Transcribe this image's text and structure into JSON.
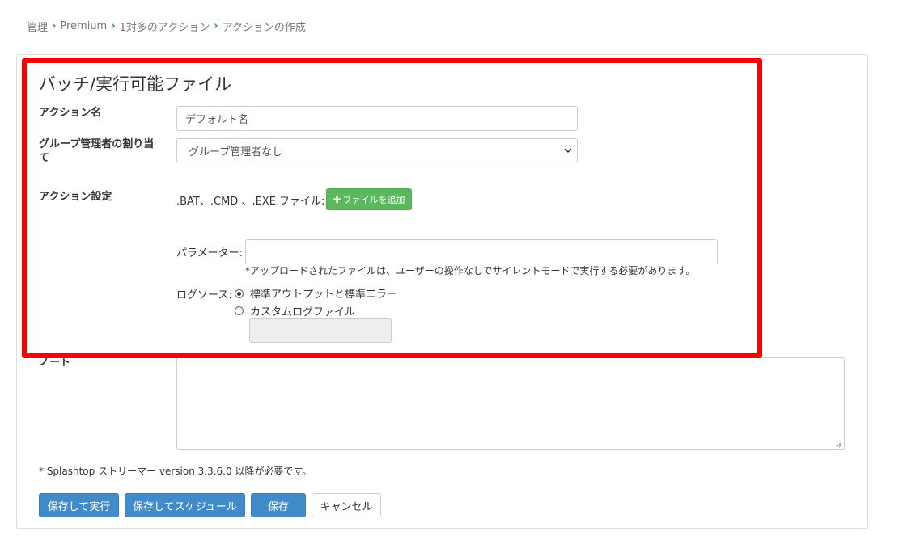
{
  "breadcrumb": {
    "items": [
      "管理",
      "Premium",
      "1対多のアクション",
      "アクションの作成"
    ]
  },
  "form": {
    "title": "バッチ/実行可能ファイル",
    "action_name_label": "アクション名",
    "action_name_value": "デフォルト名",
    "group_admin_label": "グループ管理者の割り当て",
    "group_admin_value": "グループ管理者なし",
    "action_settings_label": "アクション設定",
    "file_types_label": ".BAT、.CMD 、.EXE ファイル:",
    "add_file_button": "ファイルを追加",
    "params_label": "パラメーター:",
    "params_value": "",
    "silent_note": "*アップロードされたファイルは、ユーザーの操作なしでサイレントモードで実行する必要があります。",
    "log_source_label": "ログソース:",
    "log_options": [
      {
        "label": "標準アウトプットと標準エラー",
        "checked": true
      },
      {
        "label": "カスタムログファイル",
        "checked": false
      }
    ],
    "custom_log_value": "",
    "notes_label": "ノート",
    "notes_value": ""
  },
  "footnote": "* Splashtop ストリーマー version 3.3.6.0 以降が必要です。",
  "buttons": {
    "save_run": "保存して実行",
    "save_schedule": "保存してスケジュール",
    "save": "保存",
    "cancel": "キャンセル"
  },
  "icons": {
    "breadcrumb_separator": "chevron-right-icon",
    "add": "plus-icon",
    "dropdown": "chevron-down-icon",
    "resize": "resize-grip-icon"
  },
  "colors": {
    "highlight": "#ff0000",
    "primary": "#428bca",
    "success": "#5cb85c",
    "separator": "#2f7bb8"
  }
}
